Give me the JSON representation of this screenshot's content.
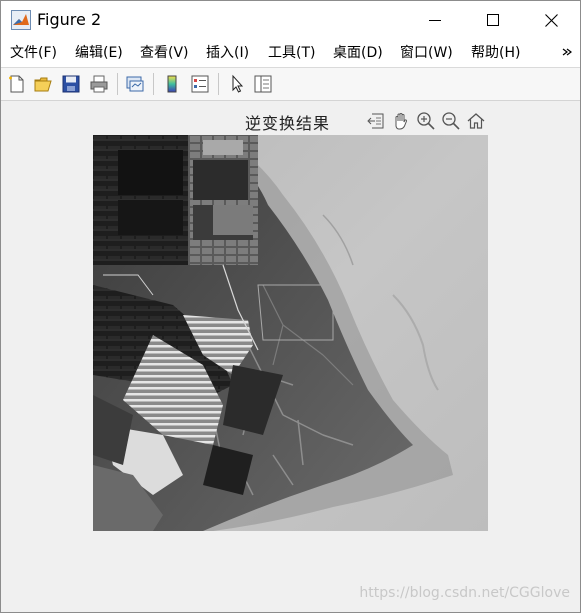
{
  "window": {
    "title": "Figure 2"
  },
  "menubar": {
    "items": [
      {
        "label": "文件(F)"
      },
      {
        "label": "编辑(E)"
      },
      {
        "label": "查看(V)"
      },
      {
        "label": "插入(I)"
      },
      {
        "label": "工具(T)"
      },
      {
        "label": "桌面(D)"
      },
      {
        "label": "窗口(W)"
      },
      {
        "label": "帮助(H)"
      }
    ]
  },
  "toolbar": {
    "buttons": [
      "new-figure-icon",
      "open-file-icon",
      "save-icon",
      "print-icon",
      "link-plot-icon",
      "colorbar-icon",
      "legend-icon",
      "pointer-icon",
      "property-inspector-icon"
    ]
  },
  "axes": {
    "title": "逆变换结果",
    "tools": [
      "brush-export-icon",
      "pan-hand-icon",
      "zoom-in-icon",
      "zoom-out-icon",
      "home-icon"
    ]
  },
  "image": {
    "description_colormap": "gray"
  },
  "watermark": "https://blog.csdn.net/CGGlove",
  "colors": {
    "titlebar": "#ffffff",
    "canvas": "#f0f0f0",
    "toolbar": "#f7f7f7"
  }
}
